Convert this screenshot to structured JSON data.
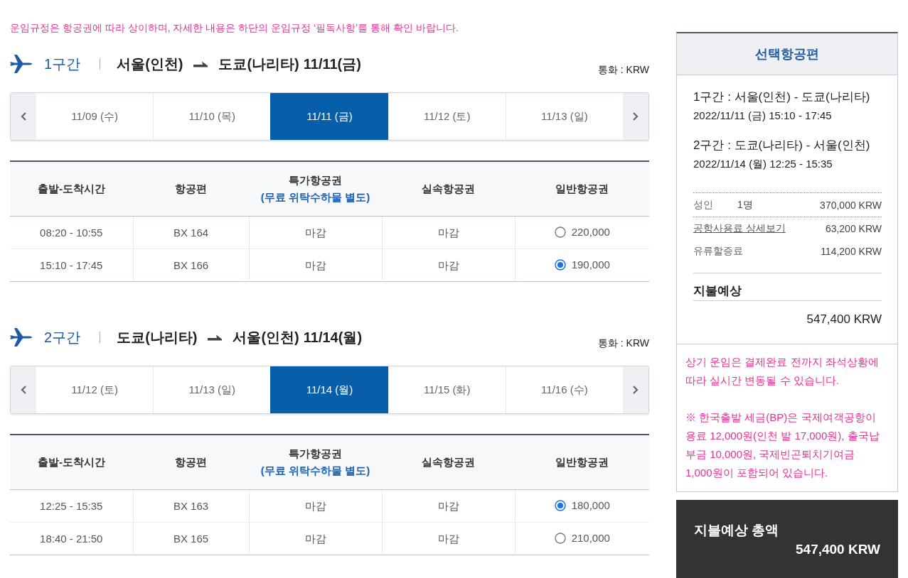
{
  "notice": "운임규정은 항공권에 따라 상이하며, 자세한 내용은 하단의 운임규정 ‘필독사항’를 통해 확인 바랍니다.",
  "segments": [
    {
      "label": "1구간",
      "origin": "서울(인천)",
      "destination": "도쿄(나리타)",
      "date": "11/11(금)",
      "currency": "통화 : KRW",
      "dates": [
        {
          "label": "11/09 (수)",
          "selected": false
        },
        {
          "label": "11/10 (목)",
          "selected": false
        },
        {
          "label": "11/11 (금)",
          "selected": true
        },
        {
          "label": "11/12 (토)",
          "selected": false
        },
        {
          "label": "11/13 (일)",
          "selected": false
        }
      ],
      "table": {
        "columns": [
          {
            "title": "출발-도착시간"
          },
          {
            "title": "항공편"
          },
          {
            "title": "특가항공권",
            "subtitle": "(무료 위탁수하물 별도)"
          },
          {
            "title": "실속항공권"
          },
          {
            "title": "일반항공권"
          }
        ],
        "rows": [
          {
            "time": "08:20 - 10:55",
            "flight": "BX 164",
            "special_fare": "마감",
            "value_fare": "마감",
            "regular_fare": "220,000",
            "selected": false
          },
          {
            "time": "15:10 - 17:45",
            "flight": "BX 166",
            "special_fare": "마감",
            "value_fare": "마감",
            "regular_fare": "190,000",
            "selected": true
          }
        ]
      }
    },
    {
      "label": "2구간",
      "origin": "도쿄(나리타)",
      "destination": "서울(인천)",
      "date": "11/14(월)",
      "currency": "통화 : KRW",
      "dates": [
        {
          "label": "11/12 (토)",
          "selected": false
        },
        {
          "label": "11/13 (일)",
          "selected": false
        },
        {
          "label": "11/14 (월)",
          "selected": true
        },
        {
          "label": "11/15 (화)",
          "selected": false
        },
        {
          "label": "11/16 (수)",
          "selected": false
        }
      ],
      "table": {
        "columns": [
          {
            "title": "출발-도착시간"
          },
          {
            "title": "항공편"
          },
          {
            "title": "특가항공권",
            "subtitle": "(무료 위탁수하물 별도)"
          },
          {
            "title": "실속항공권"
          },
          {
            "title": "일반항공권"
          }
        ],
        "rows": [
          {
            "time": "12:25 - 15:35",
            "flight": "BX 163",
            "special_fare": "마감",
            "value_fare": "마감",
            "regular_fare": "180,000",
            "selected": true
          },
          {
            "time": "18:40 - 21:50",
            "flight": "BX 165",
            "special_fare": "마감",
            "value_fare": "마감",
            "regular_fare": "210,000",
            "selected": false
          }
        ]
      }
    }
  ],
  "summary": {
    "title": "선택항공편",
    "legs": [
      {
        "route": "1구간 : 서울(인천) - 도쿄(나리타)",
        "schedule": "2022/11/11 (금) 15:10 - 17:45"
      },
      {
        "route": "2구간 : 도쿄(나리타) - 서울(인천)",
        "schedule": "2022/11/14 (월) 12:25 - 15:35"
      }
    ],
    "fares": [
      {
        "kind": "count",
        "label": "성인",
        "count": "1명",
        "amount": "370,000 KRW"
      },
      {
        "kind": "link",
        "label": "공항사용료 상세보기",
        "amount": "63,200 KRW"
      },
      {
        "kind": "plain",
        "label": "유류할증료",
        "amount": "114,200 KRW"
      }
    ],
    "estimate_label": "지불예상",
    "estimate_amount": "547,400 KRW",
    "notes": [
      "상기 운임은 결제완료 전까지 좌석상황에 따라 실시간 변동될 수 있습니다.",
      "※ 한국출발 세금(BP)은 국제여객공항이용료 12,000원(인천 발 17,000원), 출국납부금 10,000원, 국제빈곤퇴치기여금 1,000원이 포함되어 있습니다."
    ]
  },
  "total": {
    "label": "지불예상 총액",
    "amount": "547,400 KRW"
  }
}
